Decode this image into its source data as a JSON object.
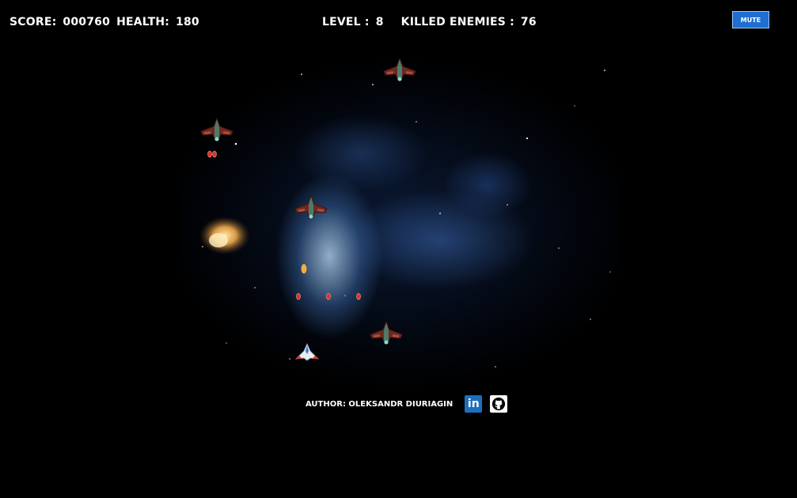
{
  "hud": {
    "score_label": "SCORE:",
    "score_value": "000760",
    "health_label": "HEALTH:",
    "health_value": "180",
    "level_label": "LEVEL :",
    "level_value": "8",
    "killed_label": "KILLED ENEMIES :",
    "killed_value": "76"
  },
  "controls": {
    "mute_label": "MUTE"
  },
  "footer": {
    "author": "AUTHOR: OLEKSANDR DIURIAGIN",
    "linkedin_glyph": "in",
    "linkedin_icon": "linkedin-icon",
    "github_icon": "github-icon"
  },
  "colors": {
    "background": "#000000",
    "mute_button": "#1f6fd1",
    "linkedin": "#1d6fbd",
    "enemy_bullet": "#e0302a"
  }
}
